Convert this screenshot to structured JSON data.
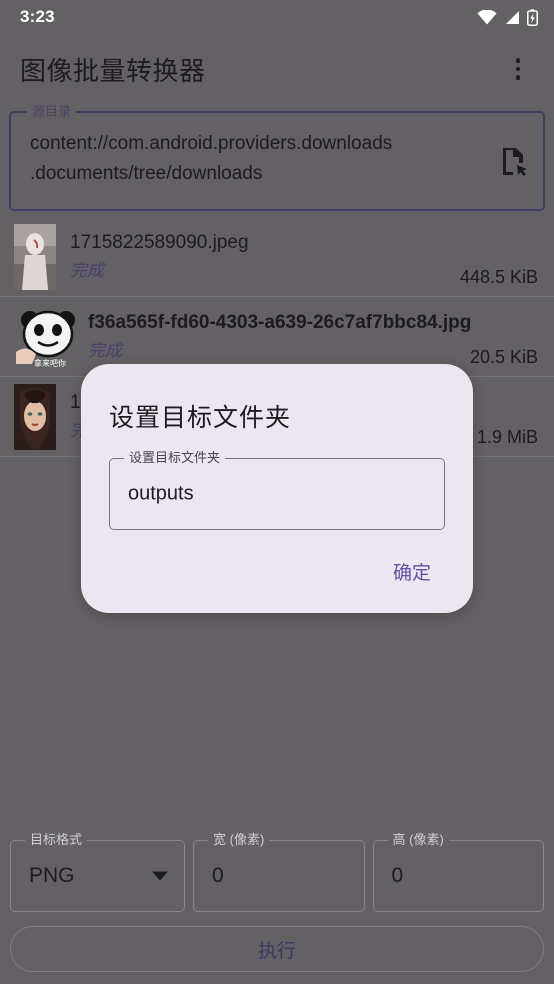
{
  "status_bar": {
    "time": "3:23",
    "icons": [
      "wifi-icon",
      "cellular-signal-icon",
      "battery-charging-icon"
    ]
  },
  "app_bar": {
    "title": "图像批量转换器",
    "overflow_menu": "overflow-menu-icon"
  },
  "source_directory": {
    "label": "源目录",
    "value": "content://com.android.providers.downloads\n.documents/tree/downloads",
    "picker_icon": "file-picker-icon"
  },
  "file_list": [
    {
      "name": "1715822589090.jpeg",
      "status": "完成",
      "size": "448.5 KiB",
      "thumbnail": "figure-photo-thumbnail"
    },
    {
      "name": "f36a565f-fd60-4303-a639-26c7af7bbc84.jpg",
      "status": "完成",
      "size": "20.5 KiB",
      "thumbnail": "panda-meme-thumbnail"
    },
    {
      "name": "1",
      "status": "完成",
      "size": "1.9 MiB",
      "thumbnail": "portrait-photo-thumbnail"
    }
  ],
  "bottom_controls": {
    "format": {
      "label": "目标格式",
      "value": "PNG"
    },
    "width": {
      "label": "宽 (像素)",
      "value": "0"
    },
    "height": {
      "label": "高 (像素)",
      "value": "0"
    },
    "execute_label": "执行"
  },
  "dialog": {
    "title": "设置目标文件夹",
    "field_label": "设置目标文件夹",
    "field_value": "outputs",
    "confirm_label": "确定"
  },
  "colors": {
    "scrim": "#646165",
    "dialog_bg": "#ece6f0",
    "accent": "#6650a4",
    "outline_accent": "#443d63",
    "text_primary": "#1d1b20"
  }
}
